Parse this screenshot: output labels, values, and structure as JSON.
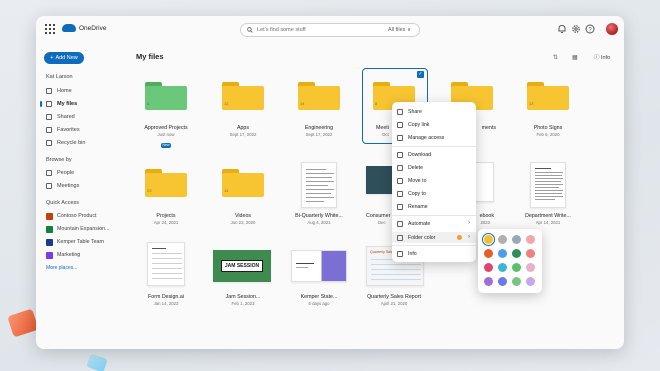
{
  "app": {
    "name": "OneDrive"
  },
  "search": {
    "placeholder": "Let's find some stuff",
    "filter": "All files ∨"
  },
  "sidebar": {
    "add_label": "Add New",
    "user": "Kat Larson",
    "nav": [
      {
        "label": "Home",
        "icon": "home-icon"
      },
      {
        "label": "My files",
        "icon": "folder-icon",
        "active": true
      },
      {
        "label": "Shared",
        "icon": "people-icon"
      },
      {
        "label": "Favorites",
        "icon": "star-icon"
      },
      {
        "label": "Recycle bin",
        "icon": "trash-icon"
      }
    ],
    "browse_by": {
      "heading": "Browse by",
      "items": [
        {
          "label": "People"
        },
        {
          "label": "Meetings"
        }
      ]
    },
    "quick_access": {
      "heading": "Quick Access",
      "items": [
        {
          "label": "Contoso Product",
          "color": "#c2410c"
        },
        {
          "label": "Mountain Expansion...",
          "color": "#15803d"
        },
        {
          "label": "Kemper Table Team",
          "color": "#1e3a8a"
        },
        {
          "label": "Marketing",
          "color": "#7c3aed"
        }
      ],
      "more": "More places..."
    }
  },
  "main": {
    "title": "My files",
    "info_label": "Info",
    "row1": [
      {
        "name": "Approved Projects",
        "date": "Just now",
        "badge": "New",
        "folder_color": "#5cbf6a",
        "count": "4"
      },
      {
        "name": "Apps",
        "date": "Sept 17, 2022",
        "folder_color": "#f5c02c",
        "count": "12"
      },
      {
        "name": "Engineering",
        "date": "Sept 17, 2022",
        "folder_color": "#f5c02c",
        "count": "14"
      },
      {
        "name": "Meeti",
        "date": "Oct",
        "folder_color": "#f5c02c",
        "count": "8"
      },
      {
        "name": "ments",
        "date": "",
        "folder_color": "#f5c02c",
        "count": ""
      },
      {
        "name": "Photo Signs",
        "date": "Feb 6, 2020",
        "folder_color": "#f5c02c",
        "count": "13"
      }
    ],
    "row2": [
      {
        "name": "Projects",
        "date": "Apr 24, 2021",
        "count": "23"
      },
      {
        "name": "Videos",
        "date": "Jun 22, 2020",
        "count": "14"
      },
      {
        "name": "Bi-Quarterly White...",
        "date": "Aug 4, 2021"
      },
      {
        "name": "Consumer",
        "date": "Dec"
      },
      {
        "name": "ebook",
        "date": "2023"
      },
      {
        "name": "Department Write...",
        "date": "Apr 14, 2021"
      }
    ],
    "row3": [
      {
        "name": "Form Design.ai",
        "date": "Jan 14, 2023"
      },
      {
        "name": "Jam Session...",
        "date": "Feb 1, 2023",
        "thumb_text": "JAM SESSION"
      },
      {
        "name": "Kemper State...",
        "date": "5 days ago"
      },
      {
        "name": "Quarterly Sales Report",
        "date": "April 21, 2020",
        "thumb_text": "Quarterly Sales Report"
      }
    ]
  },
  "context_menu": {
    "items": [
      {
        "label": "Share"
      },
      {
        "label": "Copy link"
      },
      {
        "label": "Manage access"
      },
      {
        "label": "Download"
      },
      {
        "label": "Delete"
      },
      {
        "label": "Move to"
      },
      {
        "label": "Copy to"
      },
      {
        "label": "Rename"
      },
      {
        "label": "Automate"
      },
      {
        "label": "Folder color"
      },
      {
        "label": "Info"
      }
    ]
  },
  "palette": {
    "colors": [
      "#f5c02c",
      "#b0b0b0",
      "#9aa7b5",
      "#f2a7a7",
      "#e85d27",
      "#4d9ee8",
      "#2f8f5b",
      "#f08080",
      "#e0446b",
      "#3db6d6",
      "#5cbf6a",
      "#e8b0c8",
      "#9c6fd6",
      "#6a7be8",
      "#7ac47f",
      "#c9a6e8"
    ]
  }
}
